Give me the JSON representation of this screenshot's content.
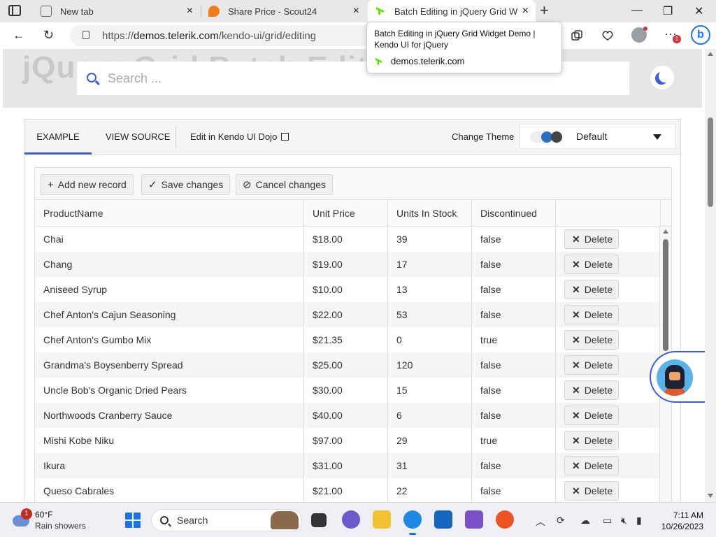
{
  "browser": {
    "tabs": [
      {
        "title": "New tab",
        "close": "×"
      },
      {
        "title": "Share Price - Scout24",
        "close": "×"
      },
      {
        "title": "Batch Editing in jQuery Grid Widget Demo | Kendo UI for jQuery",
        "close": "×"
      }
    ],
    "new_tab": "+",
    "url_prefix": "https://",
    "url_host": "demos.telerik.com",
    "url_path": "/kendo-ui/grid/editing",
    "more_badge": "1",
    "tooltip": {
      "title": "Batch Editing in jQuery Grid Widget Demo | Kendo UI for jQuery",
      "site": "demos.telerik.com"
    }
  },
  "page": {
    "bg_title": "jQuery Grid Batch Editing",
    "search_placeholder": "Search ...",
    "demo_tabs": {
      "example": "EXAMPLE",
      "view_source": "VIEW SOURCE",
      "dojo": "Edit in Kendo UI Dojo"
    },
    "change_theme_label": "Change Theme",
    "theme_value": "Default"
  },
  "grid": {
    "toolbar": {
      "add": "Add new record",
      "save": "Save changes",
      "cancel": "Cancel changes"
    },
    "columns": [
      "ProductName",
      "Unit Price",
      "Units In Stock",
      "Discontinued",
      ""
    ],
    "delete_label": "Delete",
    "rows": [
      {
        "name": "Chai",
        "price": "$18.00",
        "stock": "39",
        "disc": "false"
      },
      {
        "name": "Chang",
        "price": "$19.00",
        "stock": "17",
        "disc": "false"
      },
      {
        "name": "Aniseed Syrup",
        "price": "$10.00",
        "stock": "13",
        "disc": "false"
      },
      {
        "name": "Chef Anton's Cajun Seasoning",
        "price": "$22.00",
        "stock": "53",
        "disc": "false"
      },
      {
        "name": "Chef Anton's Gumbo Mix",
        "price": "$21.35",
        "stock": "0",
        "disc": "true"
      },
      {
        "name": "Grandma's Boysenberry Spread",
        "price": "$25.00",
        "stock": "120",
        "disc": "false"
      },
      {
        "name": "Uncle Bob's Organic Dried Pears",
        "price": "$30.00",
        "stock": "15",
        "disc": "false"
      },
      {
        "name": "Northwoods Cranberry Sauce",
        "price": "$40.00",
        "stock": "6",
        "disc": "false"
      },
      {
        "name": "Mishi Kobe Niku",
        "price": "$97.00",
        "stock": "29",
        "disc": "true"
      },
      {
        "name": "Ikura",
        "price": "$31.00",
        "stock": "31",
        "disc": "false"
      },
      {
        "name": "Queso Cabrales",
        "price": "$21.00",
        "stock": "22",
        "disc": "false"
      }
    ]
  },
  "taskbar": {
    "weather_badge": "1",
    "temperature": "60°F",
    "condition": "Rain showers",
    "search_label": "Search",
    "time": "7:11 AM",
    "date": "10/26/2023"
  },
  "colors": {
    "accent": "#3b5bdb",
    "telerik_green": "#5ce500"
  }
}
